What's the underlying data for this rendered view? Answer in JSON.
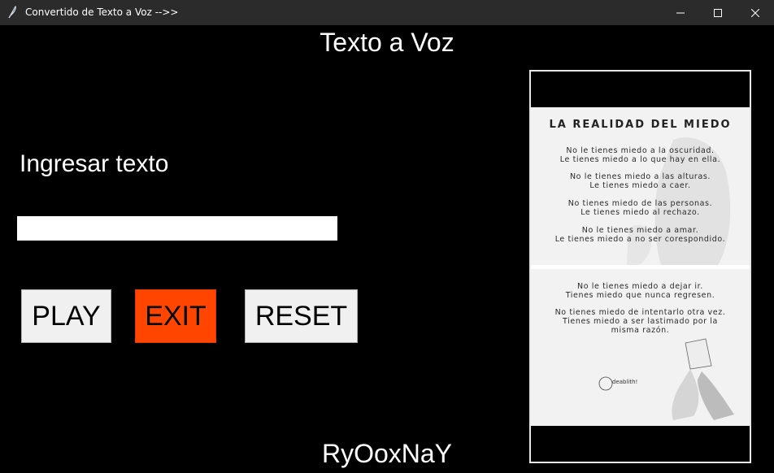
{
  "window": {
    "title": "Convertido de Texto a Voz -->>",
    "icons": [
      "feather-icon",
      "minimize-icon",
      "maximize-icon",
      "close-icon"
    ]
  },
  "heading": "Texto a Voz",
  "input_label": "Ingresar texto",
  "text_input": {
    "value": "",
    "placeholder": ""
  },
  "buttons": {
    "play": "PLAY",
    "exit": "EXIT",
    "reset": "RESET"
  },
  "colors": {
    "exit_button": "#ff4500",
    "background": "#000000",
    "titlebar": "#2b2b2b"
  },
  "poster": {
    "title": "LA REALIDAD DEL MIEDO",
    "lines": [
      "No le tienes miedo a la oscuridad.",
      "Le tienes miedo a lo que hay en ella.",
      "No le tienes miedo a las alturas.",
      "Le tienes miedo a caer.",
      "No tienes miedo de las personas.",
      "Le tienes miedo al rechazo.",
      "No le tienes miedo a amar.",
      "Le tienes miedo a no ser corespondido.",
      "No le tienes miedo a dejar ir.",
      "Tienes miedo que nunca regresen.",
      "No tienes miedo de intentarlo otra vez.",
      "Tienes miedo a ser lastimado por la",
      "misma razón."
    ],
    "signature": "deablith!"
  },
  "footer": "RyOoxNaY"
}
